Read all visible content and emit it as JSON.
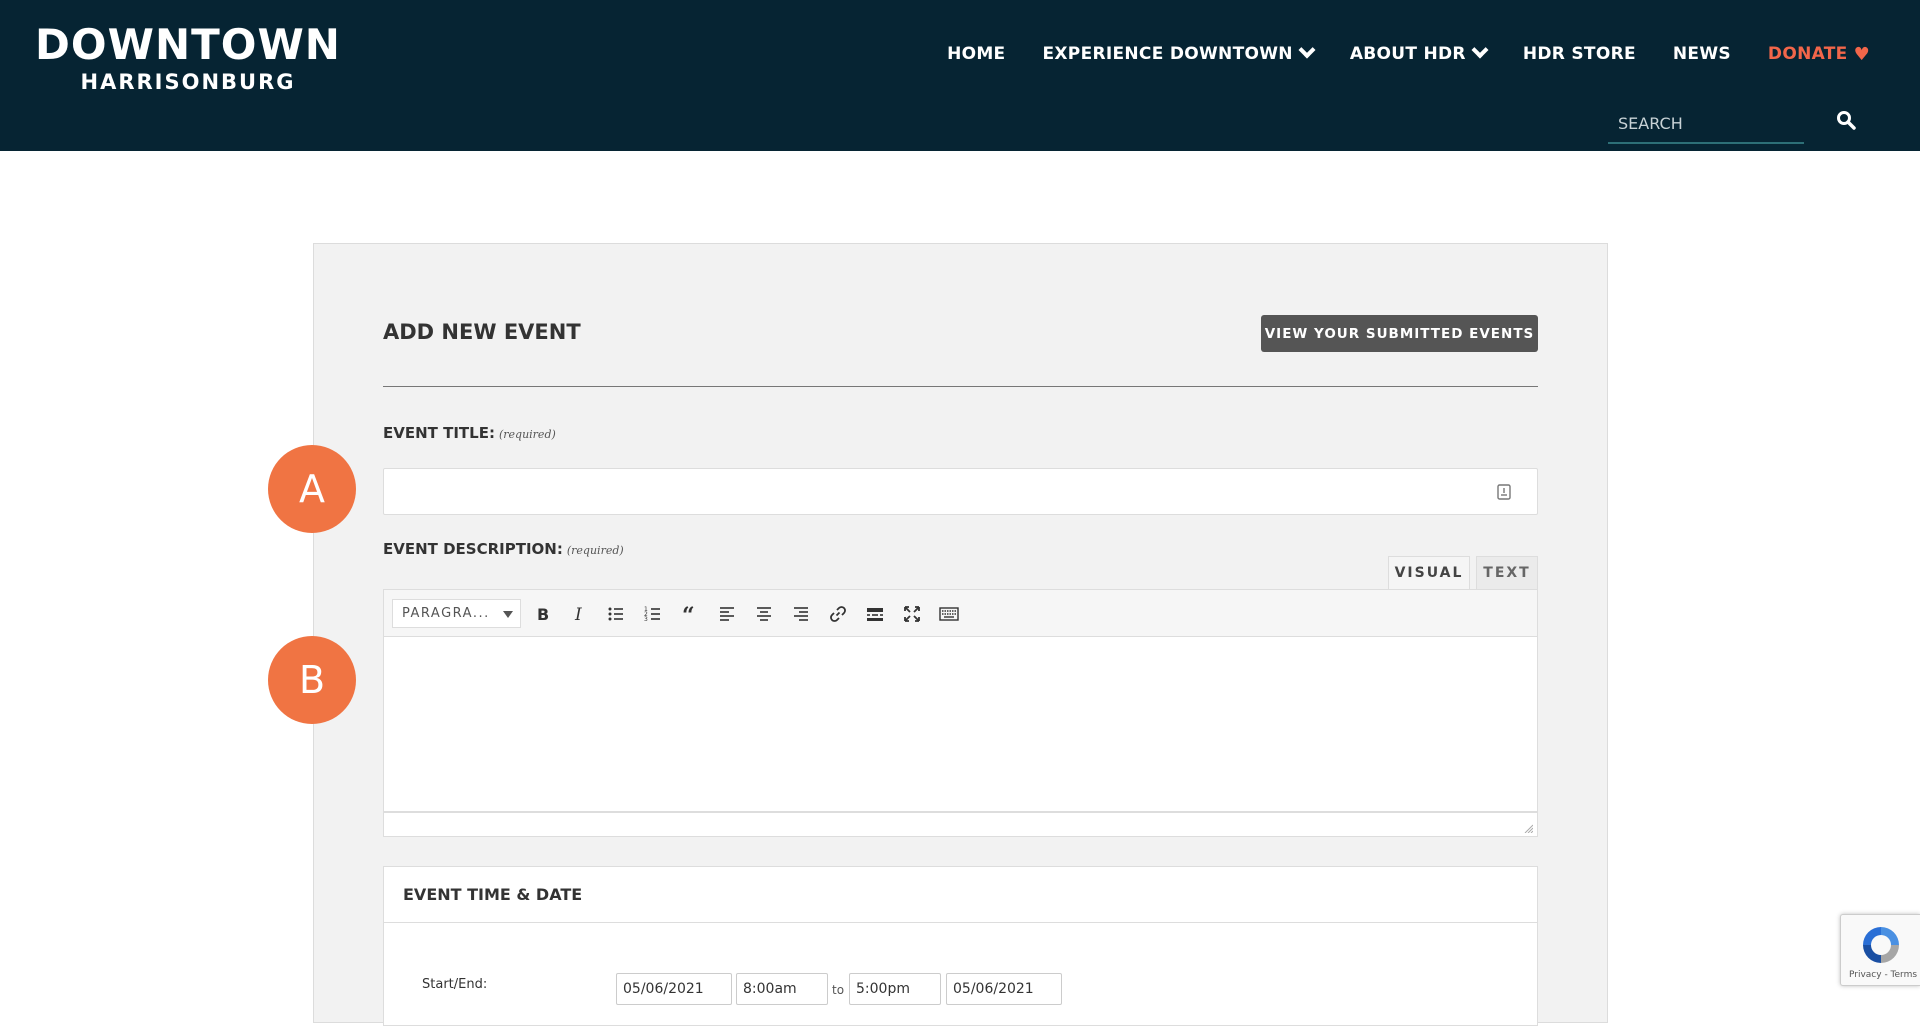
{
  "header": {
    "logo_main": "DOWNTOWN",
    "logo_sub": "HARRISONBURG",
    "nav": {
      "home": "HOME",
      "experience": "EXPERIENCE DOWNTOWN",
      "about": "ABOUT HDR",
      "store": "HDR STORE",
      "news": "NEWS",
      "donate": "DONATE"
    },
    "search": {
      "placeholder": "SEARCH",
      "icon": "search-icon"
    },
    "colors": {
      "background": "#062433",
      "accent": "#f2664a"
    }
  },
  "form": {
    "title": "ADD NEW EVENT",
    "view_button": "VIEW YOUR SUBMITTED EVENTS",
    "event_title": {
      "label": "EVENT TITLE:",
      "required": "(required)",
      "value": ""
    },
    "event_description": {
      "label": "EVENT DESCRIPTION:",
      "required": "(required)",
      "tabs": {
        "visual": "VISUAL",
        "text": "TEXT"
      },
      "format_select": "PARAGRA...",
      "toolbar_icons": [
        "bold-icon",
        "italic-icon",
        "bullet-list-icon",
        "numbered-list-icon",
        "blockquote-icon",
        "align-left-icon",
        "align-center-icon",
        "align-right-icon",
        "link-icon",
        "read-more-icon",
        "fullscreen-icon",
        "keyboard-icon"
      ]
    },
    "time_date": {
      "title": "EVENT TIME & DATE",
      "startend_label": "Start/End:",
      "start_date": "05/06/2021",
      "start_time": "8:00am",
      "to": "to",
      "end_time": "5:00pm",
      "end_date": "05/06/2021"
    }
  },
  "callouts": {
    "a": "A",
    "b": "B",
    "color": "#f07443"
  },
  "recaptcha": {
    "links": "Privacy - Terms"
  }
}
